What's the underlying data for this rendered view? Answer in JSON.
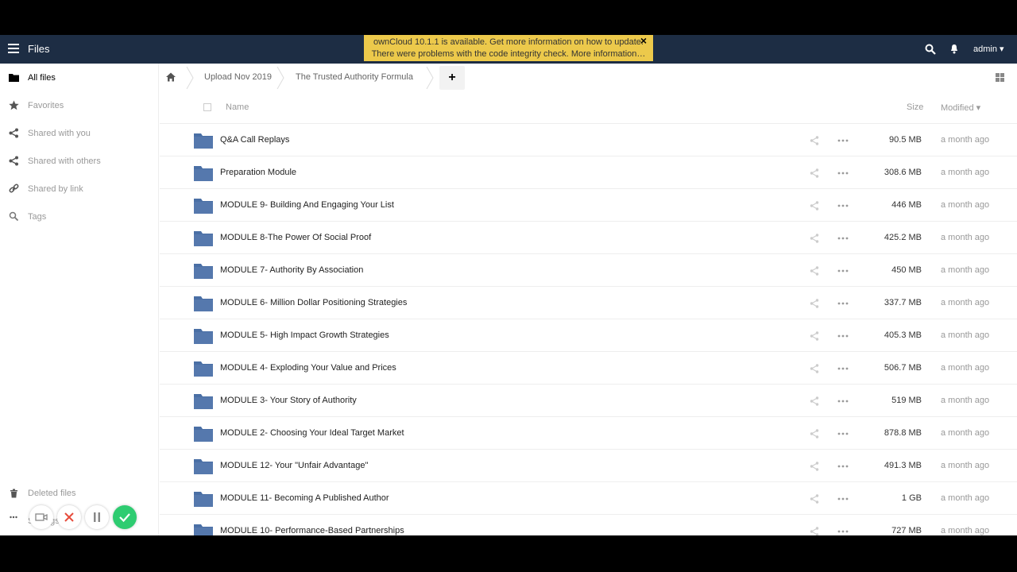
{
  "topbar": {
    "app_title": "Files",
    "notification_line1": "ownCloud 10.1.1 is available. Get more information on how to update.",
    "notification_line2": "There were problems with the code integrity check. More information…",
    "notification_close": "×",
    "user_label": "admin ▾"
  },
  "sidebar": {
    "items": [
      {
        "label": "All files",
        "icon": "folder-icon"
      },
      {
        "label": "Favorites",
        "icon": "star-icon"
      },
      {
        "label": "Shared with you",
        "icon": "share-icon"
      },
      {
        "label": "Shared with others",
        "icon": "share-icon"
      },
      {
        "label": "Shared by link",
        "icon": "link-icon"
      },
      {
        "label": "Tags",
        "icon": "search-icon"
      }
    ],
    "deleted_files": "Deleted files",
    "settings_label": "Settings"
  },
  "breadcrumb": {
    "items": [
      "Upload Nov 2019",
      "The Trusted Authority Formula"
    ],
    "new_button": "+"
  },
  "table": {
    "header": {
      "name": "Name",
      "size": "Size",
      "modified": "Modified ▾"
    },
    "rows": [
      {
        "name": "Q&A Call Replays",
        "size": "90.5 MB",
        "modified": "a month ago"
      },
      {
        "name": "Preparation Module",
        "size": "308.6 MB",
        "modified": "a month ago"
      },
      {
        "name": "MODULE 9- Building And Engaging Your List",
        "size": "446 MB",
        "modified": "a month ago"
      },
      {
        "name": "MODULE 8-The Power Of Social Proof",
        "size": "425.2 MB",
        "modified": "a month ago"
      },
      {
        "name": "MODULE 7- Authority By Association",
        "size": "450 MB",
        "modified": "a month ago"
      },
      {
        "name": "MODULE 6- Million Dollar Positioning Strategies",
        "size": "337.7 MB",
        "modified": "a month ago"
      },
      {
        "name": "MODULE 5- High Impact Growth Strategies",
        "size": "405.3 MB",
        "modified": "a month ago"
      },
      {
        "name": "MODULE 4- Exploding Your Value and Prices",
        "size": "506.7 MB",
        "modified": "a month ago"
      },
      {
        "name": "MODULE 3- Your Story of Authority",
        "size": "519 MB",
        "modified": "a month ago"
      },
      {
        "name": "MODULE 2- Choosing Your Ideal Target Market",
        "size": "878.8 MB",
        "modified": "a month ago"
      },
      {
        "name": "MODULE 12- Your \"Unfair Advantage\"",
        "size": "491.3 MB",
        "modified": "a month ago"
      },
      {
        "name": "MODULE 11- Becoming A Published Author",
        "size": "1 GB",
        "modified": "a month ago"
      },
      {
        "name": "MODULE 10- Performance-Based Partnerships",
        "size": "727 MB",
        "modified": "a month ago"
      }
    ]
  },
  "colors": {
    "topbar": "#1d2d44",
    "notification": "#ecc94b",
    "folder": "#4a6fa5",
    "record_confirm": "#2ecc71",
    "record_cancel": "#e74c3c"
  }
}
